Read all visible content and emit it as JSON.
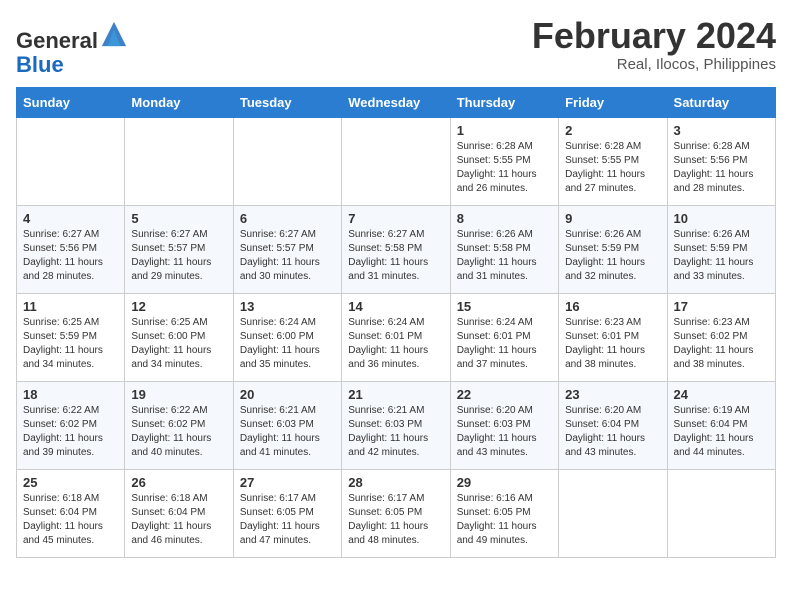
{
  "header": {
    "logo_line1": "General",
    "logo_line2": "Blue",
    "month_title": "February 2024",
    "location": "Real, Ilocos, Philippines"
  },
  "weekdays": [
    "Sunday",
    "Monday",
    "Tuesday",
    "Wednesday",
    "Thursday",
    "Friday",
    "Saturday"
  ],
  "weeks": [
    [
      {
        "day": "",
        "info": ""
      },
      {
        "day": "",
        "info": ""
      },
      {
        "day": "",
        "info": ""
      },
      {
        "day": "",
        "info": ""
      },
      {
        "day": "1",
        "info": "Sunrise: 6:28 AM\nSunset: 5:55 PM\nDaylight: 11 hours and 26 minutes."
      },
      {
        "day": "2",
        "info": "Sunrise: 6:28 AM\nSunset: 5:55 PM\nDaylight: 11 hours and 27 minutes."
      },
      {
        "day": "3",
        "info": "Sunrise: 6:28 AM\nSunset: 5:56 PM\nDaylight: 11 hours and 28 minutes."
      }
    ],
    [
      {
        "day": "4",
        "info": "Sunrise: 6:27 AM\nSunset: 5:56 PM\nDaylight: 11 hours and 28 minutes."
      },
      {
        "day": "5",
        "info": "Sunrise: 6:27 AM\nSunset: 5:57 PM\nDaylight: 11 hours and 29 minutes."
      },
      {
        "day": "6",
        "info": "Sunrise: 6:27 AM\nSunset: 5:57 PM\nDaylight: 11 hours and 30 minutes."
      },
      {
        "day": "7",
        "info": "Sunrise: 6:27 AM\nSunset: 5:58 PM\nDaylight: 11 hours and 31 minutes."
      },
      {
        "day": "8",
        "info": "Sunrise: 6:26 AM\nSunset: 5:58 PM\nDaylight: 11 hours and 31 minutes."
      },
      {
        "day": "9",
        "info": "Sunrise: 6:26 AM\nSunset: 5:59 PM\nDaylight: 11 hours and 32 minutes."
      },
      {
        "day": "10",
        "info": "Sunrise: 6:26 AM\nSunset: 5:59 PM\nDaylight: 11 hours and 33 minutes."
      }
    ],
    [
      {
        "day": "11",
        "info": "Sunrise: 6:25 AM\nSunset: 5:59 PM\nDaylight: 11 hours and 34 minutes."
      },
      {
        "day": "12",
        "info": "Sunrise: 6:25 AM\nSunset: 6:00 PM\nDaylight: 11 hours and 34 minutes."
      },
      {
        "day": "13",
        "info": "Sunrise: 6:24 AM\nSunset: 6:00 PM\nDaylight: 11 hours and 35 minutes."
      },
      {
        "day": "14",
        "info": "Sunrise: 6:24 AM\nSunset: 6:01 PM\nDaylight: 11 hours and 36 minutes."
      },
      {
        "day": "15",
        "info": "Sunrise: 6:24 AM\nSunset: 6:01 PM\nDaylight: 11 hours and 37 minutes."
      },
      {
        "day": "16",
        "info": "Sunrise: 6:23 AM\nSunset: 6:01 PM\nDaylight: 11 hours and 38 minutes."
      },
      {
        "day": "17",
        "info": "Sunrise: 6:23 AM\nSunset: 6:02 PM\nDaylight: 11 hours and 38 minutes."
      }
    ],
    [
      {
        "day": "18",
        "info": "Sunrise: 6:22 AM\nSunset: 6:02 PM\nDaylight: 11 hours and 39 minutes."
      },
      {
        "day": "19",
        "info": "Sunrise: 6:22 AM\nSunset: 6:02 PM\nDaylight: 11 hours and 40 minutes."
      },
      {
        "day": "20",
        "info": "Sunrise: 6:21 AM\nSunset: 6:03 PM\nDaylight: 11 hours and 41 minutes."
      },
      {
        "day": "21",
        "info": "Sunrise: 6:21 AM\nSunset: 6:03 PM\nDaylight: 11 hours and 42 minutes."
      },
      {
        "day": "22",
        "info": "Sunrise: 6:20 AM\nSunset: 6:03 PM\nDaylight: 11 hours and 43 minutes."
      },
      {
        "day": "23",
        "info": "Sunrise: 6:20 AM\nSunset: 6:04 PM\nDaylight: 11 hours and 43 minutes."
      },
      {
        "day": "24",
        "info": "Sunrise: 6:19 AM\nSunset: 6:04 PM\nDaylight: 11 hours and 44 minutes."
      }
    ],
    [
      {
        "day": "25",
        "info": "Sunrise: 6:18 AM\nSunset: 6:04 PM\nDaylight: 11 hours and 45 minutes."
      },
      {
        "day": "26",
        "info": "Sunrise: 6:18 AM\nSunset: 6:04 PM\nDaylight: 11 hours and 46 minutes."
      },
      {
        "day": "27",
        "info": "Sunrise: 6:17 AM\nSunset: 6:05 PM\nDaylight: 11 hours and 47 minutes."
      },
      {
        "day": "28",
        "info": "Sunrise: 6:17 AM\nSunset: 6:05 PM\nDaylight: 11 hours and 48 minutes."
      },
      {
        "day": "29",
        "info": "Sunrise: 6:16 AM\nSunset: 6:05 PM\nDaylight: 11 hours and 49 minutes."
      },
      {
        "day": "",
        "info": ""
      },
      {
        "day": "",
        "info": ""
      }
    ]
  ]
}
